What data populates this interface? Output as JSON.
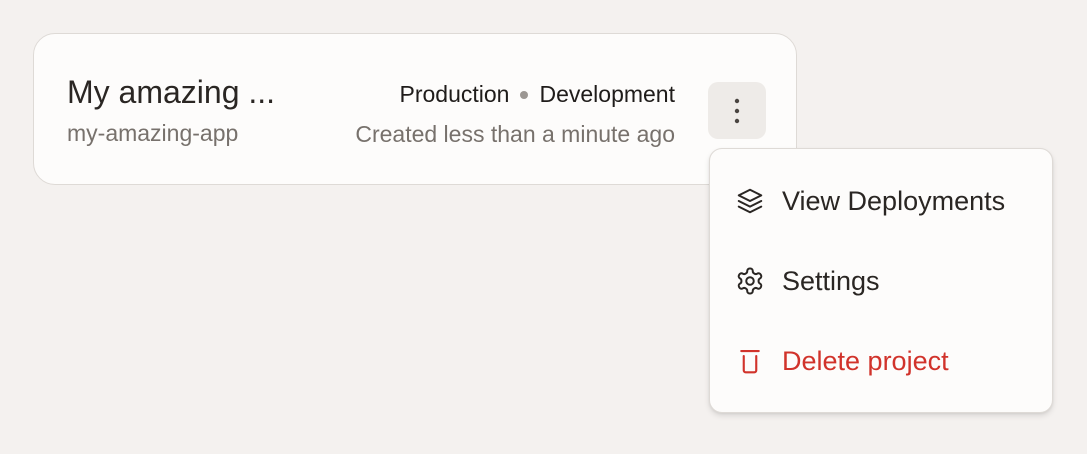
{
  "project": {
    "title": "My amazing ...",
    "slug": "my-amazing-app",
    "environments": [
      "Production",
      "Development"
    ],
    "created": "Created less than a minute ago"
  },
  "menu": {
    "items": [
      {
        "label": "View Deployments",
        "icon": "layers-icon"
      },
      {
        "label": "Settings",
        "icon": "gear-icon"
      },
      {
        "label": "Delete project",
        "icon": "trash-icon"
      }
    ]
  },
  "colors": {
    "background": "#f4f1ef",
    "card": "#fdfcfb",
    "danger": "#d1332b",
    "muted_text": "#77716c"
  }
}
